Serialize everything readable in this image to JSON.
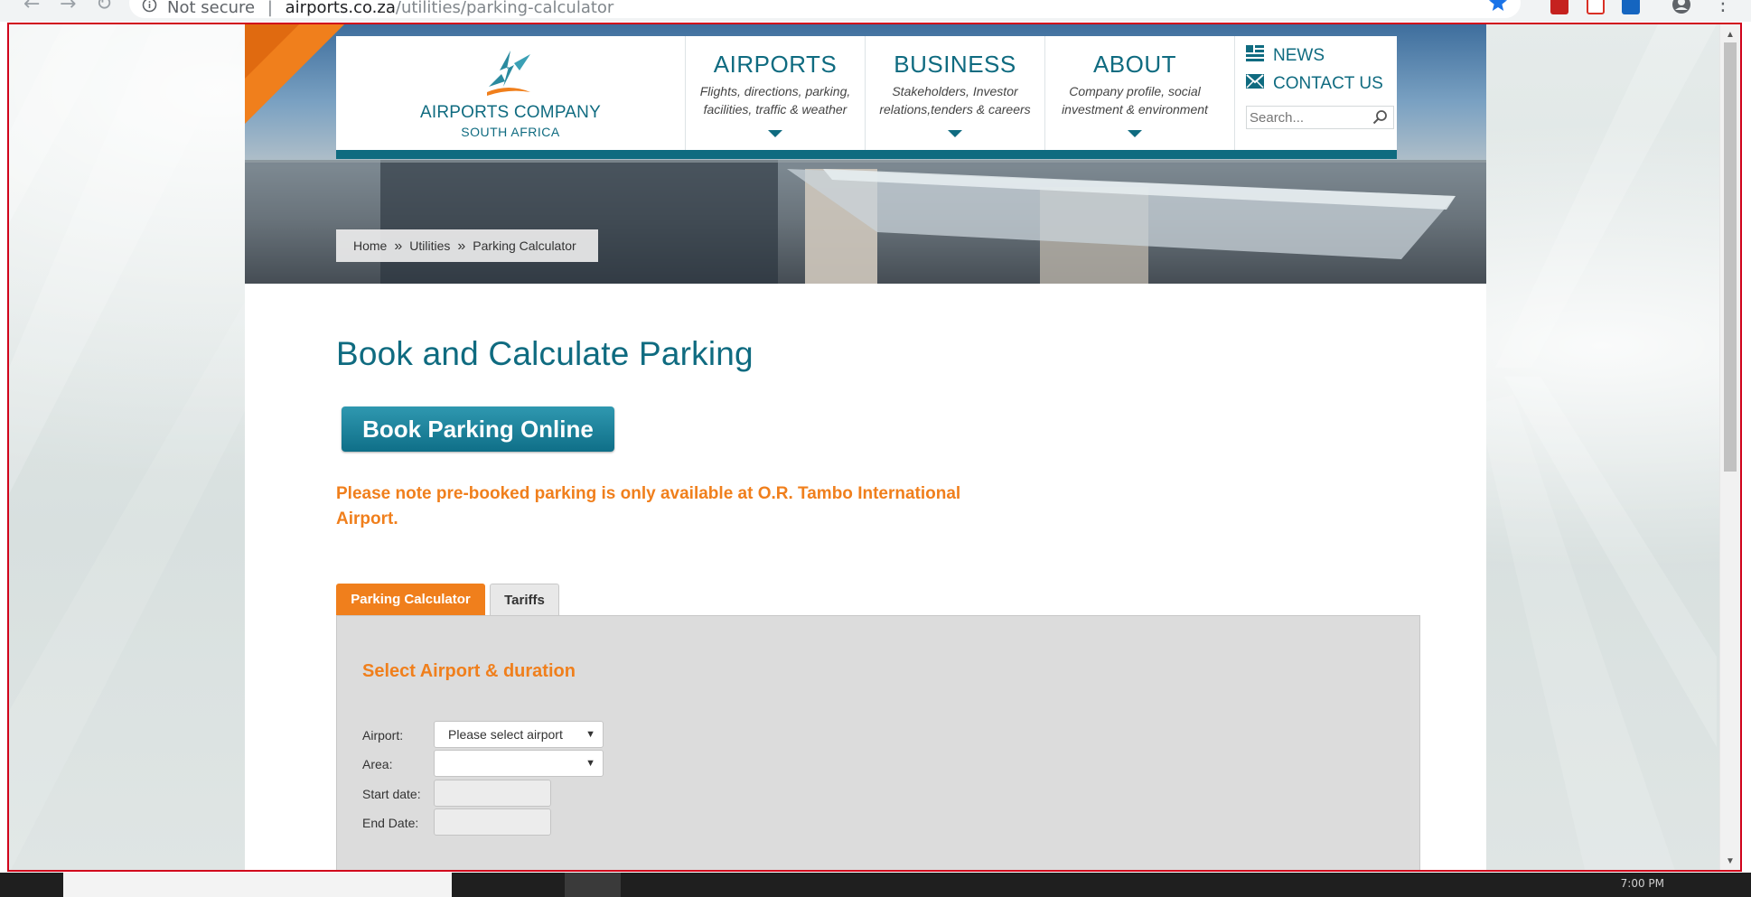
{
  "browser": {
    "security_label": "Not secure",
    "address_separator": "|",
    "url_host": "airports.co.za",
    "url_path": "/utilities/parking-calculator"
  },
  "brand": {
    "name": "AIRPORTS COMPANY",
    "subtitle": "SOUTH AFRICA",
    "primary_color": "#0f6b80",
    "accent_color": "#f07f1c"
  },
  "nav": [
    {
      "title": "AIRPORTS",
      "desc1": "Flights, directions, parking,",
      "desc2": "facilities, traffic & weather"
    },
    {
      "title": "BUSINESS",
      "desc1": "Stakeholders, Investor",
      "desc2": "relations,tenders & careers"
    },
    {
      "title": "ABOUT",
      "desc1": "Company profile, social",
      "desc2": "investment & environment"
    }
  ],
  "quick_links": {
    "news": "NEWS",
    "contact": "CONTACT US",
    "search_placeholder": "Search..."
  },
  "breadcrumb": {
    "home": "Home",
    "sep": "»",
    "utilities": "Utilities",
    "current": "Parking Calculator"
  },
  "main": {
    "title": "Book and Calculate Parking",
    "book_button": "Book Parking Online",
    "note_line1": "Please note pre-booked parking is only available at O.R. Tambo International",
    "note_line2": "Airport."
  },
  "tabs": {
    "calculator": "Parking Calculator",
    "tariffs": "Tariffs"
  },
  "form": {
    "heading": "Select Airport & duration",
    "airport_label": "Airport:",
    "airport_value": "Please select airport",
    "area_label": "Area:",
    "area_value": "",
    "start_label": "Start date:",
    "end_label": "End Date:"
  },
  "taskbar": {
    "clock": "7:00 PM"
  }
}
